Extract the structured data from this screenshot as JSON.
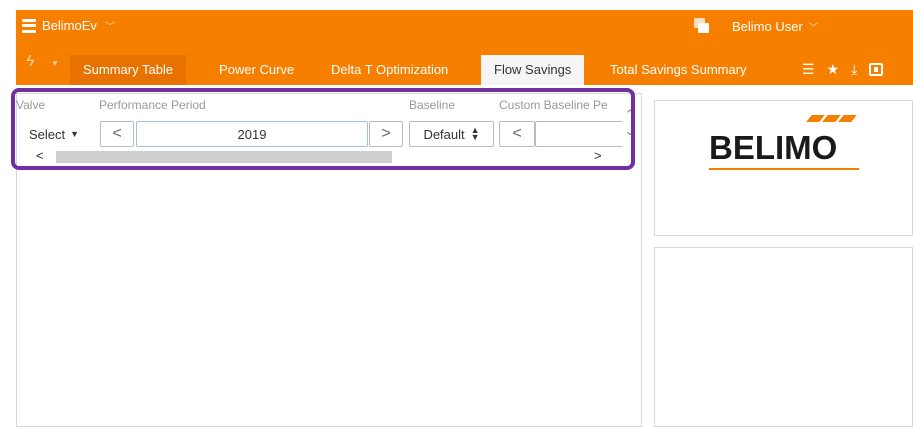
{
  "app": {
    "name": "BelimoEv",
    "user": "Belimo User"
  },
  "tabs": [
    {
      "label": "Summary Table"
    },
    {
      "label": "Power Curve"
    },
    {
      "label": "Delta T Optimization"
    },
    {
      "label": "Flow Savings",
      "active": true
    },
    {
      "label": "Total Savings Summary"
    }
  ],
  "toolbar_icons": [
    "list-icon",
    "star-icon",
    "download-icon",
    "present-icon"
  ],
  "filters": {
    "valve_label": "Valve",
    "valve_value": "Select",
    "period_label": "Performance Period",
    "period_value": "2019",
    "prev_glyph": "<",
    "next_glyph": ">",
    "baseline_label": "Baseline",
    "baseline_value": "Default",
    "custom_label": "Custom Baseline Pe"
  },
  "logo": {
    "text": "BELIMO"
  },
  "colors": {
    "accent": "#f77f00",
    "highlight": "#7030a0"
  }
}
